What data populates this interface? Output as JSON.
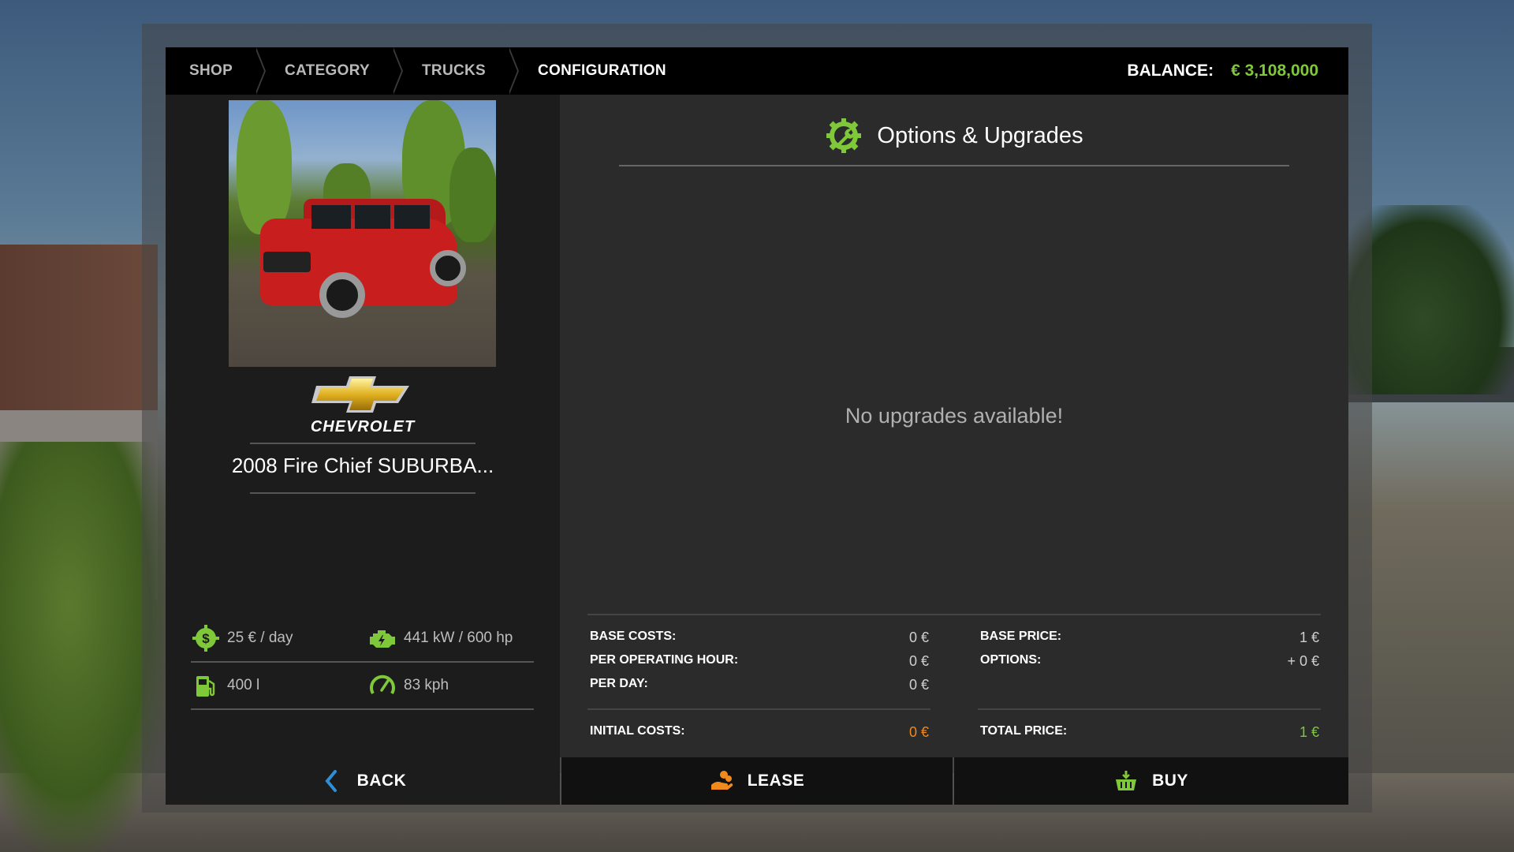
{
  "breadcrumb": [
    "SHOP",
    "CATEGORY",
    "TRUCKS",
    "CONFIGURATION"
  ],
  "balance": {
    "label": "BALANCE:",
    "value": "€ 3,108,000"
  },
  "vehicle": {
    "brand": "CHEVROLET",
    "name": "2008 Fire Chief SUBURBA..."
  },
  "specs": {
    "maintenance": "25 € / day",
    "power": "441 kW / 600 hp",
    "fuel": "400 l",
    "speed": "83 kph"
  },
  "options": {
    "title": "Options & Upgrades",
    "empty": "No upgrades available!"
  },
  "costs": {
    "base_costs_label": "BASE COSTS:",
    "base_costs": "0 €",
    "per_hour_label": "PER OPERATING HOUR:",
    "per_hour": "0 €",
    "per_day_label": "PER DAY:",
    "per_day": "0 €",
    "initial_label": "INITIAL COSTS:",
    "initial": "0 €",
    "base_price_label": "BASE PRICE:",
    "base_price": "1 €",
    "options_label": "OPTIONS:",
    "options": "+ 0 €",
    "total_label": "TOTAL PRICE:",
    "total": "1 €"
  },
  "buttons": {
    "back": "BACK",
    "lease": "LEASE",
    "buy": "BUY"
  },
  "colors": {
    "accent_green": "#7ec83a",
    "accent_orange": "#f08a1c",
    "back_blue": "#2f8fd6"
  },
  "icons": [
    "dollar-gear-icon",
    "engine-icon",
    "fuel-pump-icon",
    "speedometer-icon",
    "wrench-gear-icon",
    "chevron-left-icon",
    "hand-coins-icon",
    "basket-icon"
  ]
}
